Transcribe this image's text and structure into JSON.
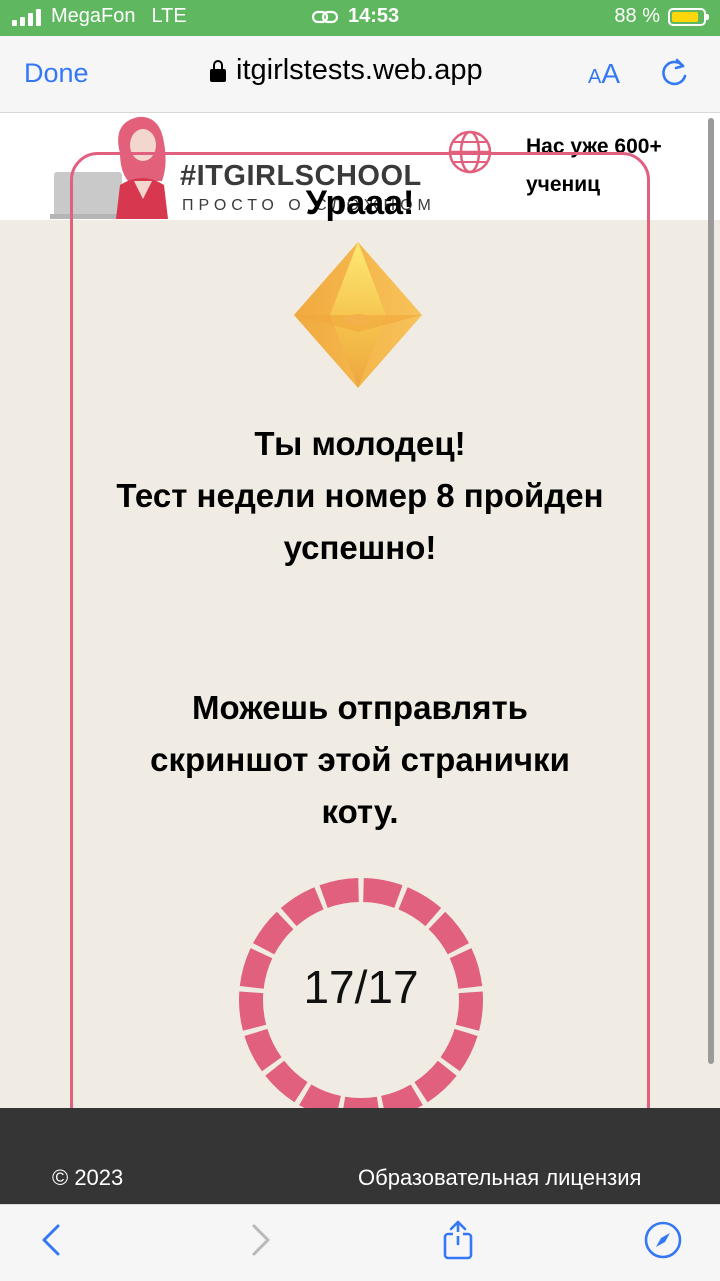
{
  "status_bar": {
    "carrier": "MegaFon",
    "network": "LTE",
    "time": "14:53",
    "battery_text": "88 %",
    "battery_level": 0.88,
    "icons": [
      "signal-icon",
      "link-icon",
      "battery-icon"
    ]
  },
  "browser": {
    "done_label": "Done",
    "url": "itgirlstests.web.app",
    "aa_small": "A",
    "aa_big": "A",
    "icons": [
      "lock-icon",
      "reload-icon"
    ],
    "accent_color": "#3478f6"
  },
  "header": {
    "logo_title": "#ITGIRLSCHOOL",
    "logo_subtitle": "ПРОСТО О СЛОЖНОМ",
    "note_line1": "Нас уже 600+",
    "note_line2": "учениц",
    "icons": [
      "logo-girl-icon",
      "globe-icon"
    ]
  },
  "card": {
    "title": "Урааа!",
    "message1": [
      "Ты молодец!",
      "Тест недели номер 8 пройден",
      "успешно!"
    ],
    "message2": [
      "Можешь отправлять",
      "скриншот этой странички",
      "коту."
    ],
    "score_text": "17/17",
    "progress": 1.0,
    "segments": 17,
    "accent_color": "#e0607e"
  },
  "footer": {
    "copyright": "© 2023",
    "license": "Образовательная лицензия"
  },
  "toolbar": {
    "icons": [
      "back-icon",
      "forward-icon",
      "share-icon",
      "compass-icon"
    ]
  }
}
